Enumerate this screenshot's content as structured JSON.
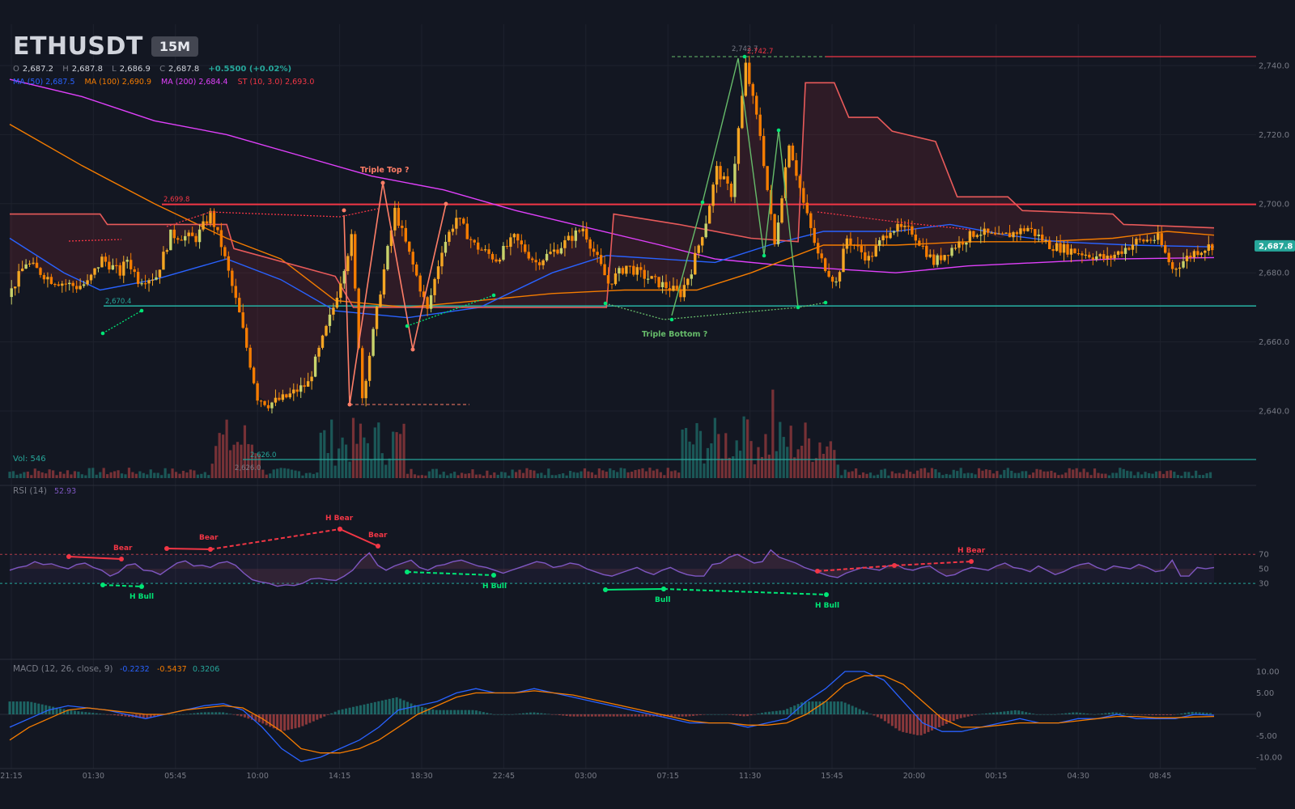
{
  "header": {
    "symbol": "ETHUSDT",
    "timeframe": "15M",
    "ohlc": {
      "o_label": "O",
      "o": "2,687.2",
      "h_label": "H",
      "h": "2,687.8",
      "l_label": "L",
      "l": "2,686.9",
      "c_label": "C",
      "c": "2,687.8",
      "change": "+0.5500 (+0.02%)"
    },
    "indicators": [
      {
        "label": "MA (50)",
        "value": "2,687.5",
        "color": "#2962ff"
      },
      {
        "label": "MA (100)",
        "value": "2,690.9",
        "color": "#f57c00"
      },
      {
        "label": "MA (200)",
        "value": "2,684.4",
        "color": "#e040fb"
      },
      {
        "label": "ST (10, 3.0)",
        "value": "2,693.0",
        "color": "#f23645"
      }
    ]
  },
  "price_axis": {
    "ticks": [
      "2,640.0",
      "2,660.0",
      "2,680.0",
      "2,700.0",
      "2,720.0",
      "2,740.0"
    ],
    "current": "2,687.8"
  },
  "time_axis": {
    "labels": [
      "21:15",
      "01:30",
      "05:45",
      "10:00",
      "14:15",
      "18:30",
      "22:45",
      "03:00",
      "07:15",
      "11:30",
      "15:45",
      "20:00",
      "00:15",
      "04:30",
      "08:45"
    ]
  },
  "annotations": {
    "resistance": "2,699.8",
    "support": "2,670.4",
    "low": "2,626.0",
    "high_a": "2,742.7",
    "high_b": "2,742.7",
    "triple_top": "Triple Top ?",
    "triple_bottom": "Triple Bottom ?"
  },
  "volume": {
    "label": "Vol: 546"
  },
  "rsi": {
    "title": "RSI (14)",
    "value": "52.93",
    "ticks": [
      "70",
      "50",
      "30"
    ],
    "divergence_labels": [
      "Bear",
      "Bear",
      "H Bear",
      "Bear",
      "H Bull",
      "H Bull",
      "Bull",
      "H Bull",
      "H Bear"
    ]
  },
  "macd": {
    "title": "MACD (12, 26, close, 9)",
    "macd": "-0.2232",
    "signal": "-0.5437",
    "hist": "0.3206",
    "ticks": [
      "10.00",
      "5.00",
      "0",
      "-5.00",
      "-10.00"
    ]
  },
  "colors": {
    "bg": "#131722",
    "up": "#26a69a",
    "down": "#ef5350",
    "candle": "#f5a623",
    "candle_alt": "#c8d36b",
    "rsi": "#7e57c2",
    "bear": "#f23645",
    "bull": "#00e676"
  },
  "chart_data": {
    "type": "line",
    "title": "ETHUSDT 15M",
    "price_range": [
      2624,
      2746
    ],
    "time_ticks": [
      "21:15",
      "01:30",
      "05:45",
      "10:00",
      "14:15",
      "18:30",
      "22:45",
      "03:00",
      "07:15",
      "11:30",
      "15:45",
      "20:00",
      "00:15",
      "04:30",
      "08:45"
    ],
    "close_series": [
      {
        "t": 0,
        "v": 2673
      },
      {
        "t": 5,
        "v": 2683
      },
      {
        "t": 12,
        "v": 2678
      },
      {
        "t": 19,
        "v": 2676
      },
      {
        "t": 22,
        "v": 2677
      },
      {
        "t": 26,
        "v": 2684
      },
      {
        "t": 31,
        "v": 2680
      },
      {
        "t": 33,
        "v": 2684
      },
      {
        "t": 36,
        "v": 2678
      },
      {
        "t": 41,
        "v": 2679
      },
      {
        "t": 45,
        "v": 2691
      },
      {
        "t": 52,
        "v": 2690
      },
      {
        "t": 56,
        "v": 2697
      },
      {
        "t": 59,
        "v": 2688
      },
      {
        "t": 61,
        "v": 2680
      },
      {
        "t": 64,
        "v": 2668
      },
      {
        "t": 69,
        "v": 2644
      },
      {
        "t": 72,
        "v": 2642
      },
      {
        "t": 77,
        "v": 2644
      },
      {
        "t": 83,
        "v": 2648
      },
      {
        "t": 90,
        "v": 2670
      },
      {
        "t": 95,
        "v": 2690
      },
      {
        "t": 98,
        "v": 2644
      },
      {
        "t": 103,
        "v": 2675
      },
      {
        "t": 107,
        "v": 2698
      },
      {
        "t": 113,
        "v": 2679
      },
      {
        "t": 116,
        "v": 2669
      },
      {
        "t": 120,
        "v": 2687
      },
      {
        "t": 124,
        "v": 2696
      },
      {
        "t": 129,
        "v": 2688
      },
      {
        "t": 135,
        "v": 2684
      },
      {
        "t": 140,
        "v": 2690
      },
      {
        "t": 146,
        "v": 2683
      },
      {
        "t": 152,
        "v": 2687
      },
      {
        "t": 159,
        "v": 2693
      },
      {
        "t": 166,
        "v": 2677
      },
      {
        "t": 171,
        "v": 2682
      },
      {
        "t": 176,
        "v": 2679
      },
      {
        "t": 182,
        "v": 2676
      },
      {
        "t": 186,
        "v": 2674
      },
      {
        "t": 189,
        "v": 2681
      },
      {
        "t": 193,
        "v": 2695
      },
      {
        "t": 196,
        "v": 2710
      },
      {
        "t": 200,
        "v": 2703
      },
      {
        "t": 204,
        "v": 2740
      },
      {
        "t": 208,
        "v": 2720
      },
      {
        "t": 212,
        "v": 2688
      },
      {
        "t": 216,
        "v": 2718
      },
      {
        "t": 220,
        "v": 2700
      },
      {
        "t": 224,
        "v": 2685
      },
      {
        "t": 229,
        "v": 2677
      },
      {
        "t": 232,
        "v": 2690
      },
      {
        "t": 238,
        "v": 2684
      },
      {
        "t": 244,
        "v": 2693
      },
      {
        "t": 250,
        "v": 2692
      },
      {
        "t": 256,
        "v": 2683
      },
      {
        "t": 262,
        "v": 2688
      },
      {
        "t": 268,
        "v": 2692
      },
      {
        "t": 274,
        "v": 2690
      },
      {
        "t": 282,
        "v": 2693
      },
      {
        "t": 288,
        "v": 2688
      },
      {
        "t": 296,
        "v": 2686
      },
      {
        "t": 304,
        "v": 2684
      },
      {
        "t": 312,
        "v": 2689
      },
      {
        "t": 318,
        "v": 2690
      },
      {
        "t": 322,
        "v": 2681
      },
      {
        "t": 328,
        "v": 2686
      },
      {
        "t": 333,
        "v": 2688
      }
    ],
    "ma50": [
      [
        0,
        2690
      ],
      [
        15,
        2680
      ],
      [
        25,
        2675
      ],
      [
        40,
        2678
      ],
      [
        60,
        2684
      ],
      [
        75,
        2678
      ],
      [
        90,
        2669
      ],
      [
        110,
        2667
      ],
      [
        130,
        2670
      ],
      [
        150,
        2680
      ],
      [
        165,
        2685
      ],
      [
        180,
        2684
      ],
      [
        195,
        2683
      ],
      [
        210,
        2688
      ],
      [
        225,
        2692
      ],
      [
        245,
        2692
      ],
      [
        260,
        2694
      ],
      [
        275,
        2691
      ],
      [
        290,
        2689
      ],
      [
        310,
        2688
      ],
      [
        333,
        2687.5
      ]
    ],
    "ma100": [
      [
        0,
        2723
      ],
      [
        20,
        2711
      ],
      [
        40,
        2700
      ],
      [
        60,
        2690
      ],
      [
        75,
        2684
      ],
      [
        90,
        2672
      ],
      [
        110,
        2670
      ],
      [
        130,
        2672
      ],
      [
        150,
        2674
      ],
      [
        170,
        2675
      ],
      [
        190,
        2675
      ],
      [
        205,
        2680
      ],
      [
        225,
        2688
      ],
      [
        245,
        2688
      ],
      [
        265,
        2689
      ],
      [
        285,
        2689
      ],
      [
        305,
        2690
      ],
      [
        320,
        2692
      ],
      [
        333,
        2690.9
      ]
    ],
    "ma200": [
      [
        0,
        2736
      ],
      [
        20,
        2731
      ],
      [
        40,
        2724
      ],
      [
        60,
        2720
      ],
      [
        80,
        2714
      ],
      [
        100,
        2708
      ],
      [
        120,
        2704
      ],
      [
        140,
        2698
      ],
      [
        160,
        2693
      ],
      [
        180,
        2688
      ],
      [
        195,
        2684
      ],
      [
        215,
        2682
      ],
      [
        230,
        2681
      ],
      [
        245,
        2680
      ],
      [
        265,
        2682
      ],
      [
        285,
        2683
      ],
      [
        305,
        2684
      ],
      [
        333,
        2684.4
      ]
    ],
    "supertrend": [
      [
        0,
        2697
      ],
      [
        25,
        2697
      ],
      [
        27,
        2694
      ],
      [
        60,
        2694
      ],
      [
        62,
        2687
      ],
      [
        90,
        2679
      ],
      [
        95,
        2670
      ],
      [
        100,
        2670
      ],
      [
        165,
        2670
      ],
      [
        167,
        2697
      ],
      [
        185,
        2694
      ],
      [
        205,
        2690
      ],
      [
        218,
        2689
      ],
      [
        220,
        2735
      ],
      [
        228,
        2735
      ],
      [
        232,
        2725
      ],
      [
        240,
        2725
      ],
      [
        244,
        2721
      ],
      [
        256,
        2718
      ],
      [
        262,
        2702
      ],
      [
        276,
        2702
      ],
      [
        280,
        2698
      ],
      [
        305,
        2697
      ],
      [
        308,
        2694
      ],
      [
        333,
        2693
      ]
    ],
    "levels": {
      "resistance": 2699.8,
      "support": 2670.4,
      "low": 2626.0,
      "high": 2742.7
    },
    "rsi": {
      "range": [
        0,
        100
      ],
      "upper": 70,
      "lower": 30,
      "values": [
        48,
        52,
        54,
        60,
        56,
        57,
        53,
        50,
        56,
        58,
        52,
        48,
        40,
        45,
        55,
        57,
        48,
        47,
        42,
        50,
        58,
        61,
        54,
        55,
        52,
        58,
        60,
        55,
        44,
        35,
        32,
        30,
        26,
        28,
        27,
        30,
        36,
        37,
        35,
        34,
        40,
        48,
        62,
        72,
        55,
        48,
        54,
        58,
        62,
        52,
        48,
        54,
        56,
        60,
        62,
        58,
        54,
        52,
        48,
        44,
        48,
        52,
        56,
        60,
        58,
        52,
        54,
        58,
        56,
        50,
        46,
        42,
        40,
        44,
        48,
        52,
        46,
        42,
        48,
        52,
        46,
        42,
        40,
        40,
        56,
        58,
        66,
        70,
        64,
        58,
        60,
        76,
        66,
        62,
        58,
        52,
        48,
        44,
        40,
        38,
        44,
        48,
        52,
        50,
        48,
        54,
        56,
        50,
        48,
        52,
        54,
        46,
        40,
        42,
        48,
        52,
        50,
        48,
        54,
        58,
        52,
        50,
        46,
        54,
        48,
        42,
        46,
        52,
        56,
        58,
        52,
        48,
        54,
        52,
        50,
        56,
        52,
        46,
        48,
        62,
        40,
        40,
        52,
        50,
        52
      ]
    },
    "macd": {
      "range": [
        -12,
        12
      ],
      "macd": [
        -3,
        -1,
        1,
        2,
        1.5,
        1,
        0,
        -1,
        0,
        1,
        2,
        2.5,
        1,
        -3,
        -8,
        -11,
        -10,
        -8,
        -6,
        -3,
        1,
        2,
        3,
        5,
        6,
        5,
        5,
        6,
        5,
        4,
        3,
        2,
        1,
        0,
        -1,
        -2,
        -2,
        -2,
        -3,
        -2,
        -1,
        3,
        6,
        10,
        10,
        8,
        3,
        -2,
        -4,
        -4,
        -3,
        -2,
        -1,
        -2,
        -2,
        -1,
        -1,
        0,
        -1,
        -1,
        -1,
        0,
        -0.2
      ],
      "signal": [
        -6,
        -3,
        -1,
        1,
        1.5,
        1,
        0.5,
        0,
        0,
        1,
        1.5,
        2,
        1.5,
        -1,
        -4,
        -8,
        -9,
        -9,
        -8,
        -6,
        -3,
        0,
        2,
        4,
        5,
        5,
        5,
        5.5,
        5,
        4.5,
        3.5,
        2.5,
        1.5,
        0.5,
        -0.5,
        -1.5,
        -2,
        -2,
        -2.5,
        -2.5,
        -2,
        0,
        3,
        7,
        9,
        9,
        7,
        3,
        -1,
        -3,
        -3,
        -2.5,
        -2,
        -2,
        -2,
        -1.5,
        -1,
        -0.5,
        -0.5,
        -0.8,
        -0.8,
        -0.6,
        -0.5
      ],
      "hist": [
        3,
        3,
        2,
        1,
        0.5,
        0,
        -0.5,
        -1,
        0,
        0,
        0.5,
        0.5,
        -0.5,
        -2,
        -4,
        -3,
        -1,
        1,
        2,
        3,
        4,
        2,
        1,
        1,
        1,
        0,
        0,
        0.5,
        0,
        -0.5,
        -0.5,
        -0.5,
        -0.5,
        -0.5,
        -0.5,
        -0.5,
        0,
        0,
        -0.5,
        0.5,
        1,
        3,
        3,
        3,
        1,
        -1,
        -4,
        -5,
        -3,
        -1,
        0,
        0.5,
        1,
        0,
        0,
        0.5,
        0,
        0.5,
        0,
        -0.2,
        -0.2,
        0.6,
        0.3
      ]
    }
  }
}
